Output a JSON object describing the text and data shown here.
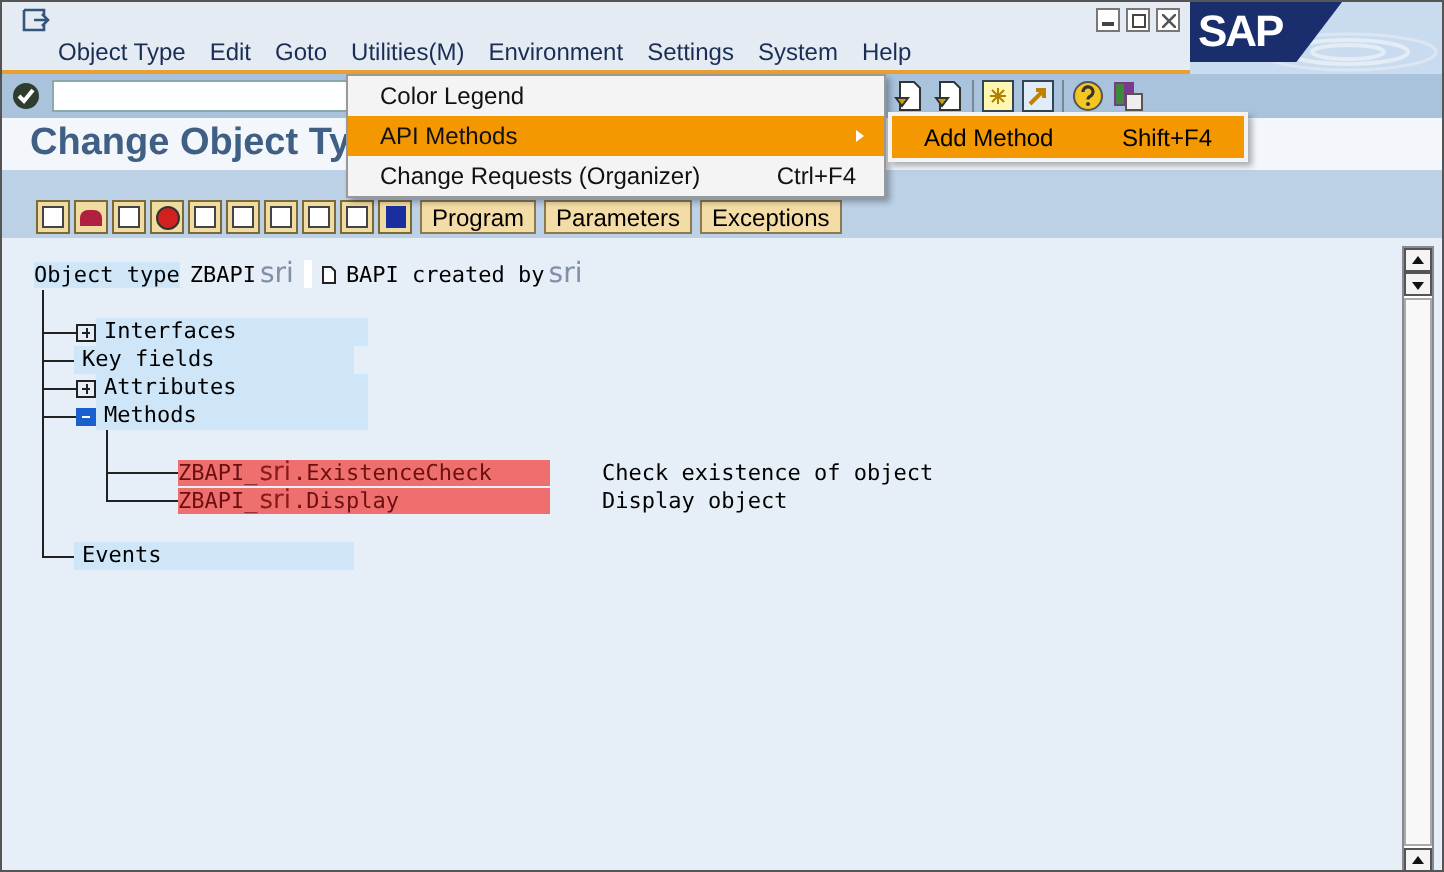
{
  "menubar": [
    "Object Type",
    "Edit",
    "Goto",
    "Utilities(M)",
    "Environment",
    "Settings",
    "System",
    "Help"
  ],
  "logo": "SAP",
  "title": "Change Object Ty",
  "app_toolbar": {
    "buttons": [
      "Program",
      "Parameters",
      "Exceptions"
    ]
  },
  "header": {
    "label": "Object type",
    "name": "ZBAPI",
    "user": "sri",
    "description": "BAPI created by",
    "desc_user": "sri"
  },
  "tree": [
    {
      "label": "Interfaces",
      "kind": "folder",
      "expanded": false
    },
    {
      "label": "Key fields",
      "kind": "leaf"
    },
    {
      "label": "Attributes",
      "kind": "folder",
      "expanded": false
    },
    {
      "label": "Methods",
      "kind": "folder",
      "expanded": true,
      "children": [
        {
          "prefix": "ZBAPI_",
          "user": "sri",
          "suffix": ".ExistenceCheck",
          "description": "Check existence of object"
        },
        {
          "prefix": "ZBAPI_",
          "user": "sri",
          "suffix": ".Display",
          "description": "Display object"
        }
      ]
    },
    {
      "label": "Events",
      "kind": "leaf"
    }
  ],
  "menu": [
    {
      "label": "Color Legend",
      "has_submenu": false,
      "selected": false
    },
    {
      "label": "API Methods",
      "has_submenu": true,
      "selected": true
    },
    {
      "label": "Change Requests (Organizer)",
      "shortcut": "Ctrl+F4",
      "has_submenu": false,
      "selected": false
    }
  ],
  "submenu": [
    {
      "label": "Add Method",
      "shortcut": "Shift+F4",
      "selected": true
    }
  ]
}
